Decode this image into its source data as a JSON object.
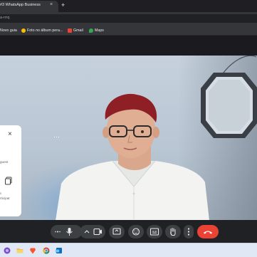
{
  "browser": {
    "tab_title": "#3 WhatsApp Business",
    "tab_close_glyph": "×",
    "new_tab_glyph": "+",
    "url": "a-rrrq",
    "bookmarks": [
      {
        "label": "Novo guia",
        "icon": "page-icon",
        "color": "#8ab4f8"
      },
      {
        "label": "Foto no álbum pera...",
        "icon": "photos-icon",
        "color": "#fbbc04"
      },
      {
        "label": "Gmail",
        "icon": "gmail-icon",
        "color": "#ea4335"
      },
      {
        "label": "Maps",
        "icon": "maps-icon",
        "color": "#34a853"
      }
    ]
  },
  "meeting": {
    "side_panel": {
      "close_glyph": "×",
      "text_line_1": "guest",
      "text_line_2": "c",
      "text_line_3": "rticipat"
    },
    "more_dots": "⋯",
    "controls": [
      {
        "name": "captions-button",
        "icon": "captions-icon"
      },
      {
        "name": "microphone-button",
        "icon": "microphone-icon"
      },
      {
        "name": "camera-options-button",
        "icon": "chevron-up-icon"
      },
      {
        "name": "camera-button",
        "icon": "camera-icon"
      },
      {
        "name": "present-button",
        "icon": "present-icon"
      },
      {
        "name": "reactions-button",
        "icon": "emoji-icon"
      },
      {
        "name": "captions-toggle-button",
        "icon": "cc-icon"
      },
      {
        "name": "raise-hand-button",
        "icon": "hand-icon"
      },
      {
        "name": "more-options-button",
        "icon": "more-vert-icon"
      },
      {
        "name": "end-call-button",
        "icon": "hang-up-icon"
      }
    ],
    "end_call_color": "#ea4335"
  },
  "taskbar": {
    "icons": [
      "start-icon",
      "file-explorer-icon",
      "brave-icon",
      "chrome-icon",
      "outlook-icon"
    ]
  }
}
